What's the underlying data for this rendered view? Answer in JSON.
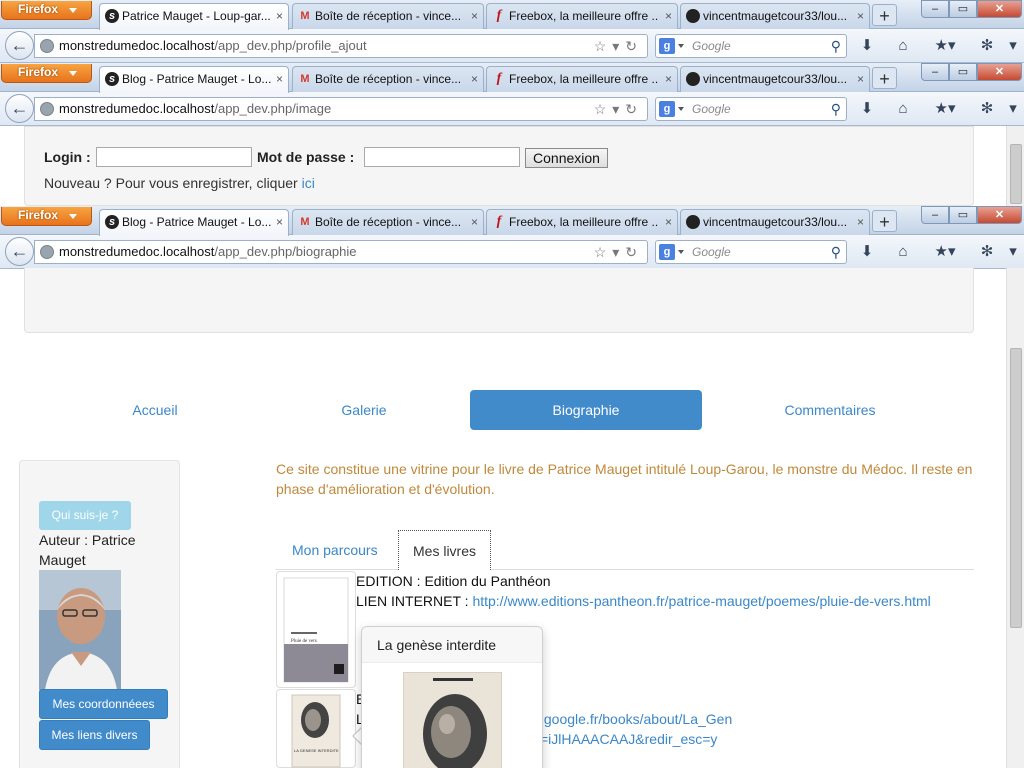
{
  "browser": {
    "menu_label": "Firefox",
    "tabs": [
      {
        "title": "Patrice Mauget - Loup-gar...",
        "icon": "sf"
      },
      {
        "title": "Blog - Patrice Mauget - Lo...",
        "icon": "sf"
      },
      {
        "title": "Boîte de réception - vince...",
        "icon": "gmail"
      },
      {
        "title": "Freebox, la meilleure offre ...",
        "icon": "free"
      },
      {
        "title": "vincentmaugetcour33/lou...",
        "icon": "github"
      }
    ],
    "windows": [
      {
        "active_tab_title": "Patrice Mauget - Loup-gar...",
        "url_host": "monstredumedoc.localhost",
        "url_path": "/app_dev.php/profile_ajout"
      },
      {
        "active_tab_title": "Blog - Patrice Mauget - Lo...",
        "url_host": "monstredumedoc.localhost",
        "url_path": "/app_dev.php/image"
      },
      {
        "active_tab_title": "Blog - Patrice Mauget - Lo...",
        "url_host": "monstredumedoc.localhost",
        "url_path": "/app_dev.php/biographie"
      }
    ],
    "search_placeholder": "Google",
    "close_glyph": "×",
    "new_tab_glyph": "+",
    "win_min": "–",
    "win_max": "▭",
    "win_close": "✕"
  },
  "login": {
    "login_label": "Login :",
    "password_label": "Mot de passe :",
    "submit_label": "Connexion",
    "signup_text": "Nouveau ? Pour vous enregistrer, cliquer ",
    "signup_link": "ici"
  },
  "nav": {
    "items": [
      "Accueil",
      "Galerie",
      "Biographie",
      "Commentaires"
    ],
    "active_index": 2
  },
  "sidebar": {
    "who_button": "Qui suis-je ?",
    "author_text": "Auteur : Patrice Mauget",
    "contact_button": "Mes coordonnéees",
    "links_button": "Mes liens divers"
  },
  "main": {
    "intro": "Ce site constitue une vitrine pour le livre de Patrice Mauget intitulé Loup-Garou, le monstre du Médoc. Il reste en phase d'amélioration et d'évolution.",
    "tabs": [
      "Mon parcours",
      "Mes livres"
    ],
    "active_tab": 1,
    "book1": {
      "edition": "EDITION : Edition du Panthéon",
      "link_label": "LIEN INTERNET : ",
      "link": "http://www.editions-pantheon.fr/patrice-mauget/poemes/pluie-de-vers.html",
      "cover_title": "Pluie de vers"
    },
    "book2": {
      "edition_partial": "E",
      "link_label_partial": "L",
      "link_line1": ".google.fr/books/about/La_Gen",
      "link_line2": "=iJlHAAACAAJ&redir_esc=y",
      "cover_title": "LA GENESE INTERDITE"
    },
    "popover_title": "La genèse interdite"
  },
  "colors": {
    "accent": "#428bca",
    "link": "#3a87c9",
    "intro_text": "#c0883b",
    "info_button": "#9fd6ea"
  }
}
